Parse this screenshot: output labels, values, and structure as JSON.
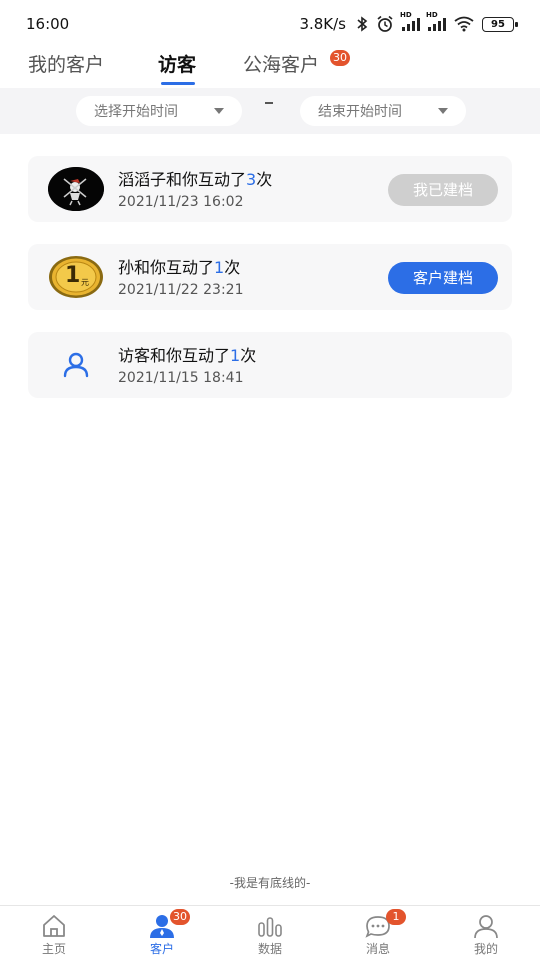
{
  "status_bar": {
    "time": "16:00",
    "net_speed": "3.8K/s",
    "hd_label": "HD",
    "battery": "95"
  },
  "tabs": [
    {
      "label": "我的客户",
      "active": false
    },
    {
      "label": "访客",
      "active": true
    },
    {
      "label": "公海客户",
      "active": false,
      "badge": "30"
    }
  ],
  "filters": {
    "start_placeholder": "选择开始时间",
    "end_placeholder": "结束开始时间",
    "separator": "-"
  },
  "visitors": [
    {
      "name_prefix": "滔滔子和你互动了",
      "count": "3",
      "suffix": "次",
      "time": "2021/11/23 16:02",
      "button": "我已建档",
      "button_style": "grey",
      "avatar": "pirate-avatar"
    },
    {
      "name_prefix": "孙和你互动了",
      "count": "1",
      "suffix": "次",
      "time": "2021/11/22 23:21",
      "button": "客户建档",
      "button_style": "blue",
      "avatar": "coin-avatar",
      "coin_text": "1",
      "coin_unit": "元"
    },
    {
      "name_prefix": "访客和你互动了",
      "count": "1",
      "suffix": "次",
      "time": "2021/11/15 18:41",
      "button": "",
      "button_style": "none",
      "avatar": "user-icon"
    }
  ],
  "footer_note": "-我是有底线的-",
  "bottom_nav": [
    {
      "label": "主页",
      "icon": "home-icon",
      "active": false
    },
    {
      "label": "客户",
      "icon": "customer-icon",
      "active": true,
      "badge": "30"
    },
    {
      "label": "数据",
      "icon": "chart-icon",
      "active": false
    },
    {
      "label": "消息",
      "icon": "message-icon",
      "active": false,
      "badge": "1"
    },
    {
      "label": "我的",
      "icon": "profile-icon",
      "active": false
    }
  ],
  "colors": {
    "accent": "#2c6ee6",
    "badge": "#e3542d",
    "archived_button": "#cfcfcf"
  }
}
